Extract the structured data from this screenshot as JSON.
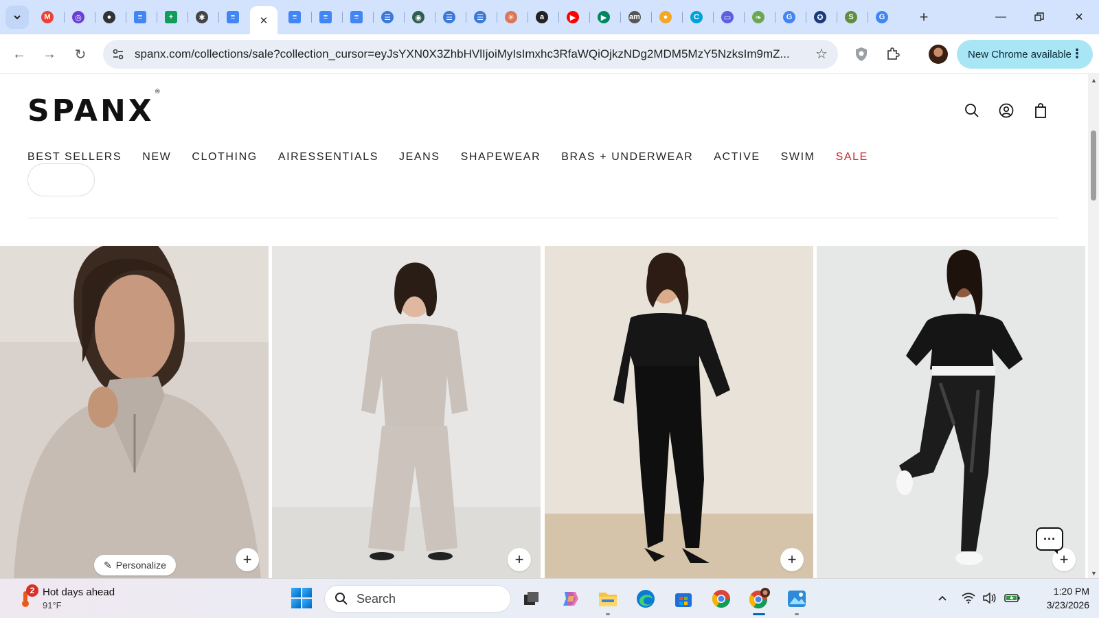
{
  "browser": {
    "tabs": [
      {
        "icon": "gmail-icon",
        "color": "#ea4335",
        "glyph": "M"
      },
      {
        "icon": "circle-app-icon",
        "color": "#6b3fd6",
        "glyph": "◎"
      },
      {
        "icon": "profile-app-icon",
        "color": "#333333",
        "glyph": "●"
      },
      {
        "icon": "google-docs-icon",
        "color": "#4285f4",
        "glyph": "≡"
      },
      {
        "icon": "google-sheets-icon",
        "color": "#0f9d58",
        "glyph": "+"
      },
      {
        "icon": "chatgpt-icon",
        "color": "#444444",
        "glyph": "✱"
      },
      {
        "icon": "google-docs-icon",
        "color": "#4285f4",
        "glyph": "≡"
      },
      {
        "icon": "google-docs-icon",
        "color": "#4285f4",
        "glyph": "≡"
      },
      {
        "icon": "google-docs-icon",
        "color": "#4285f4",
        "glyph": "≡"
      },
      {
        "icon": "google-docs-icon",
        "color": "#4285f4",
        "glyph": "≡"
      },
      {
        "icon": "google-docs-icon",
        "color": "#4285f4",
        "glyph": "≡"
      },
      {
        "icon": "circle-list-icon",
        "color": "#3c78d8",
        "glyph": "☰"
      },
      {
        "icon": "globe-app-icon",
        "color": "#2e5e4e",
        "glyph": "◉"
      },
      {
        "icon": "circle-list-icon",
        "color": "#3c78d8",
        "glyph": "☰"
      },
      {
        "icon": "circle-list-icon",
        "color": "#3c78d8",
        "glyph": "☰"
      },
      {
        "icon": "claude-icon",
        "color": "#d97757",
        "glyph": "✳"
      },
      {
        "icon": "amazon-icon",
        "color": "#222222",
        "glyph": "a"
      },
      {
        "icon": "youtube-icon",
        "color": "#ff0000",
        "glyph": "▶"
      },
      {
        "icon": "google-play-icon",
        "color": "#01875f",
        "glyph": "▶"
      },
      {
        "icon": "amazon-music-icon",
        "color": "#555555",
        "glyph": "am"
      },
      {
        "icon": "orange-app-icon",
        "color": "#f5a623",
        "glyph": "●"
      },
      {
        "icon": "canva-icon",
        "color": "#00a3d9",
        "glyph": "C"
      },
      {
        "icon": "window-app-icon",
        "color": "#5b5fe0",
        "glyph": "▭"
      },
      {
        "icon": "leaf-app-icon",
        "color": "#6aa84f",
        "glyph": "❧"
      },
      {
        "icon": "google-icon",
        "color": "#4285f4",
        "glyph": "G"
      },
      {
        "icon": "gear-app-icon",
        "color": "#1a3a7a",
        "glyph": "✪"
      },
      {
        "icon": "shopify-icon",
        "color": "#5e8e3e",
        "glyph": "S"
      },
      {
        "icon": "google-icon",
        "color": "#4285f4",
        "glyph": "G"
      }
    ],
    "active_tab_index": 7,
    "url": "spanx.com/collections/sale?collection_cursor=eyJsYXN0X3ZhbHVlIjoiMyIsImxhc3RfaWQiOjkzNDg2MDM5MzY5NzksIm9mZ...",
    "update_label": "New Chrome available"
  },
  "site": {
    "logo": "SPANX",
    "logo_mark": "®",
    "nav": [
      "BEST SELLERS",
      "NEW",
      "CLOTHING",
      "AIRESSENTIALS",
      "JEANS",
      "SHAPEWEAR",
      "BRAS + UNDERWEAR",
      "ACTIVE",
      "SWIM",
      "SALE"
    ],
    "sale_color": "#c4282f"
  },
  "products": [
    {
      "image": "model-taupe-half-zip-closeup",
      "personalize_label": "Personalize"
    },
    {
      "image": "model-taupe-sweater-wide-pants"
    },
    {
      "image": "model-black-sweater-leggings"
    },
    {
      "image": "model-black-pullover-faux-leather-leggings"
    }
  ],
  "taskbar": {
    "weather_title": "Hot days ahead",
    "weather_temp": "91°F",
    "weather_badge": "2",
    "search_placeholder": "Search",
    "time": "1:20 PM",
    "date": "3/23/2026"
  }
}
